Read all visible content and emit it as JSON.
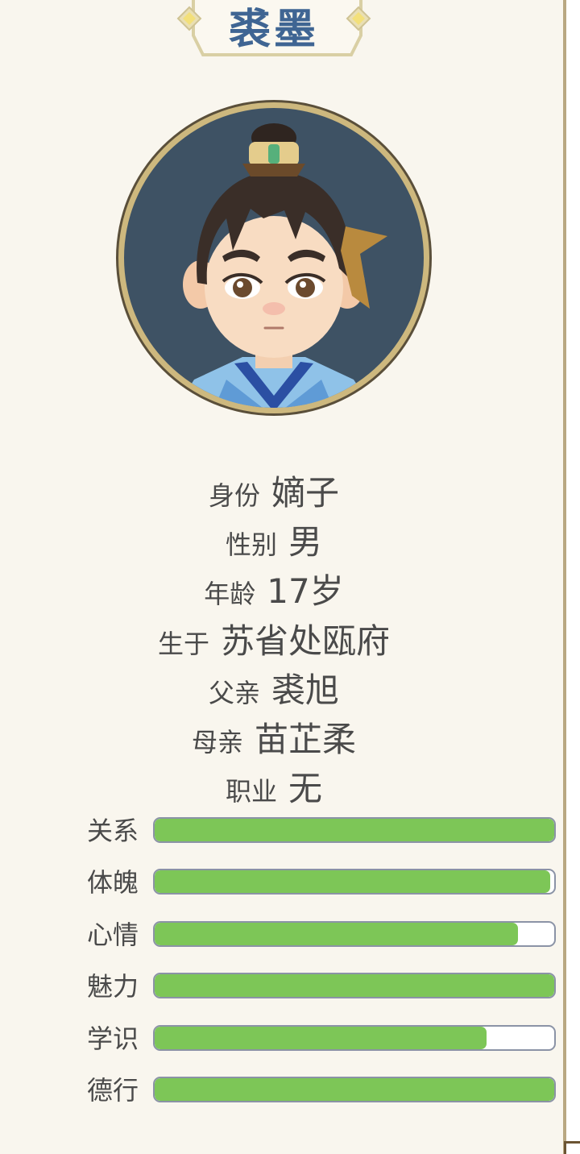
{
  "character": {
    "name": "裘墨",
    "info": [
      {
        "label": "身份",
        "value": "嫡子"
      },
      {
        "label": "性别",
        "value": "男"
      },
      {
        "label": "年龄",
        "value": "17岁"
      },
      {
        "label": "生于",
        "value": "苏省处瓯府"
      },
      {
        "label": "父亲",
        "value": "裘旭"
      },
      {
        "label": "母亲",
        "value": "苗芷柔"
      },
      {
        "label": "职业",
        "value": "无"
      }
    ],
    "stats": [
      {
        "label": "关系",
        "fill": 1.0
      },
      {
        "label": "体魄",
        "fill": 0.99
      },
      {
        "label": "心情",
        "fill": 0.91
      },
      {
        "label": "魅力",
        "fill": 1.0
      },
      {
        "label": "学识",
        "fill": 0.83
      },
      {
        "label": "德行",
        "fill": 1.0
      }
    ]
  },
  "colors": {
    "bar_fill": "#7dc657",
    "bar_border": "#8b93a6",
    "title": "#3f6593",
    "text": "#4a4a4a",
    "background": "#f9f6ee",
    "frame_gold": "#d9cfa4"
  },
  "icons": {
    "portrait": "boy-avatar",
    "title_ornament": "diamond-ornament"
  }
}
